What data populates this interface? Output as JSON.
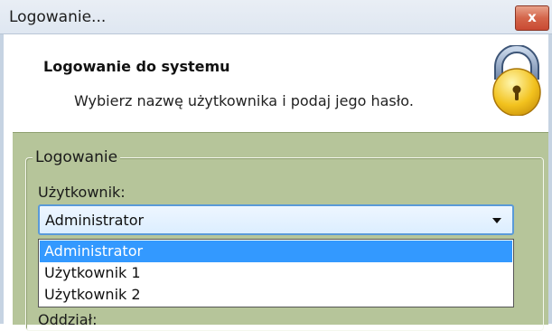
{
  "window": {
    "title": "Logowanie...",
    "close_label": "x"
  },
  "header": {
    "title": "Logowanie do systemu",
    "subtitle": "Wybierz nazwę użytkownika i podaj jego hasło.",
    "icon": "lock-icon"
  },
  "group": {
    "label": "Logowanie"
  },
  "user": {
    "label": "Użytkownik:",
    "selected": "Administrator",
    "options": [
      "Administrator",
      "Użytkownik 1",
      "Użytkownik 2"
    ]
  },
  "branch": {
    "label": "Oddział:"
  },
  "colors": {
    "panel": "#b6c59a",
    "selection": "#3399ff"
  }
}
